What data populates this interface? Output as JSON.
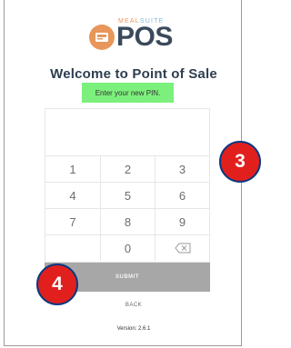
{
  "brand": {
    "small_text_a": "MEAL",
    "small_text_b": "SUITE",
    "product": "POS",
    "logo_icon": "pos-logo-icon",
    "accent_color": "#e8965a"
  },
  "heading": "Welcome to Point of Sale",
  "instruction": "Enter your new PIN.",
  "keypad": {
    "keys": [
      "1",
      "2",
      "3",
      "4",
      "5",
      "6",
      "7",
      "8",
      "9",
      "",
      "0",
      ""
    ],
    "backspace_icon": "backspace-icon"
  },
  "submit_label": "SUBMIT",
  "back_label": "BACK",
  "version": "Version: 2.6.1",
  "callouts": [
    "3",
    "4"
  ],
  "colors": {
    "callout_fill": "#e1201d",
    "callout_border": "#0a3880",
    "instruction_bg": "#7cf07c",
    "submit_bg": "#a7a7a7"
  }
}
